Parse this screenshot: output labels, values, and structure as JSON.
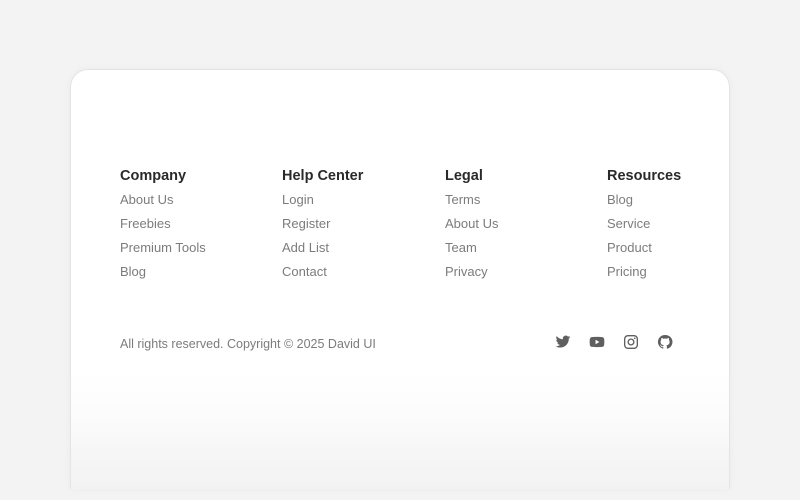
{
  "footer": {
    "columns": [
      {
        "title": "Company",
        "links": [
          "About Us",
          "Freebies",
          "Premium Tools",
          "Blog"
        ]
      },
      {
        "title": "Help Center",
        "links": [
          "Login",
          "Register",
          "Add List",
          "Contact"
        ]
      },
      {
        "title": "Legal",
        "links": [
          "Terms",
          "About Us",
          "Team",
          "Privacy"
        ]
      },
      {
        "title": "Resources",
        "links": [
          "Blog",
          "Service",
          "Product",
          "Pricing"
        ]
      }
    ],
    "copyright": "All rights reserved. Copyright © 2025 David UI",
    "socials": [
      "twitter-icon",
      "youtube-icon",
      "instagram-icon",
      "github-icon"
    ]
  },
  "colors": {
    "heading": "#2a2a2a",
    "link": "#7c7c7c",
    "icon": "#5f5f5f",
    "card": "#ffffff",
    "page": "#f3f3f3"
  }
}
